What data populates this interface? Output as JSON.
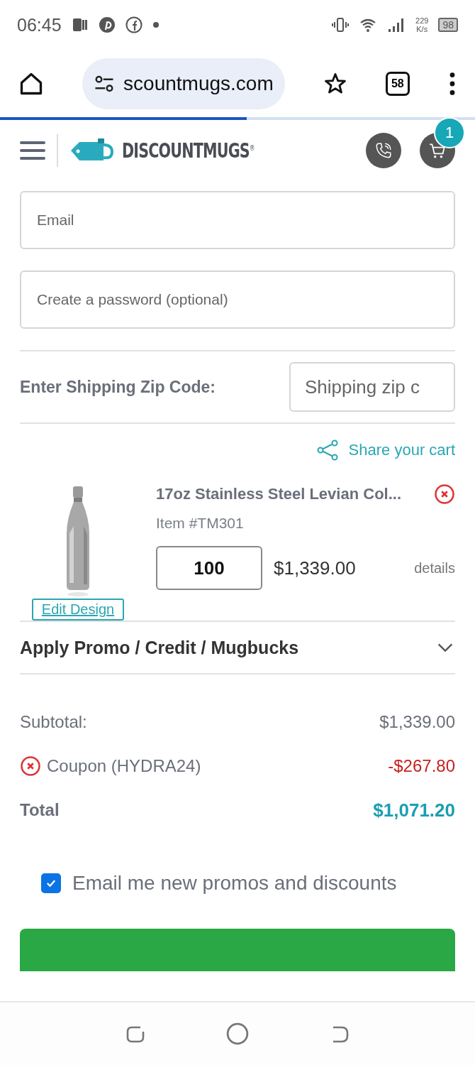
{
  "status_bar": {
    "time": "06:45",
    "network_speed": "229",
    "network_unit": "K/s",
    "battery": "98"
  },
  "browser": {
    "url": "scountmugs.com",
    "tab_count": "58",
    "load_progress": {
      "level": 0.52
    }
  },
  "site_header": {
    "logo": "DISCOUNTMUGS",
    "logo_mark": "®",
    "cart_count": "1"
  },
  "account": {
    "email": {
      "placeholder": "Email"
    },
    "password": {
      "placeholder": "Create a password (optional)"
    }
  },
  "shipping": {
    "label": "Enter Shipping Zip Code:",
    "zip": {
      "placeholder": "Shipping zip c"
    }
  },
  "share_link": "Share your cart",
  "cart_items": [
    {
      "title": "17oz Stainless Steel Levian Col...",
      "item_number": "Item #TM301",
      "quantity": "100",
      "price": "$1,339.00",
      "details_link": "details",
      "edit_button": "Edit Design"
    }
  ],
  "promo": {
    "label": "Apply Promo / Credit / Mugbucks",
    "expanded": false
  },
  "totals": [
    {
      "kind": "subtotal",
      "label": "Subtotal:",
      "value": "$1,339.00"
    },
    {
      "kind": "coupon",
      "label": "Coupon (HYDRA24)",
      "value": "-$267.80"
    },
    {
      "kind": "total",
      "label": "Total",
      "value": "$1,071.20"
    }
  ],
  "newsletter": {
    "label": "Email me new promos and discounts",
    "checked": true
  }
}
